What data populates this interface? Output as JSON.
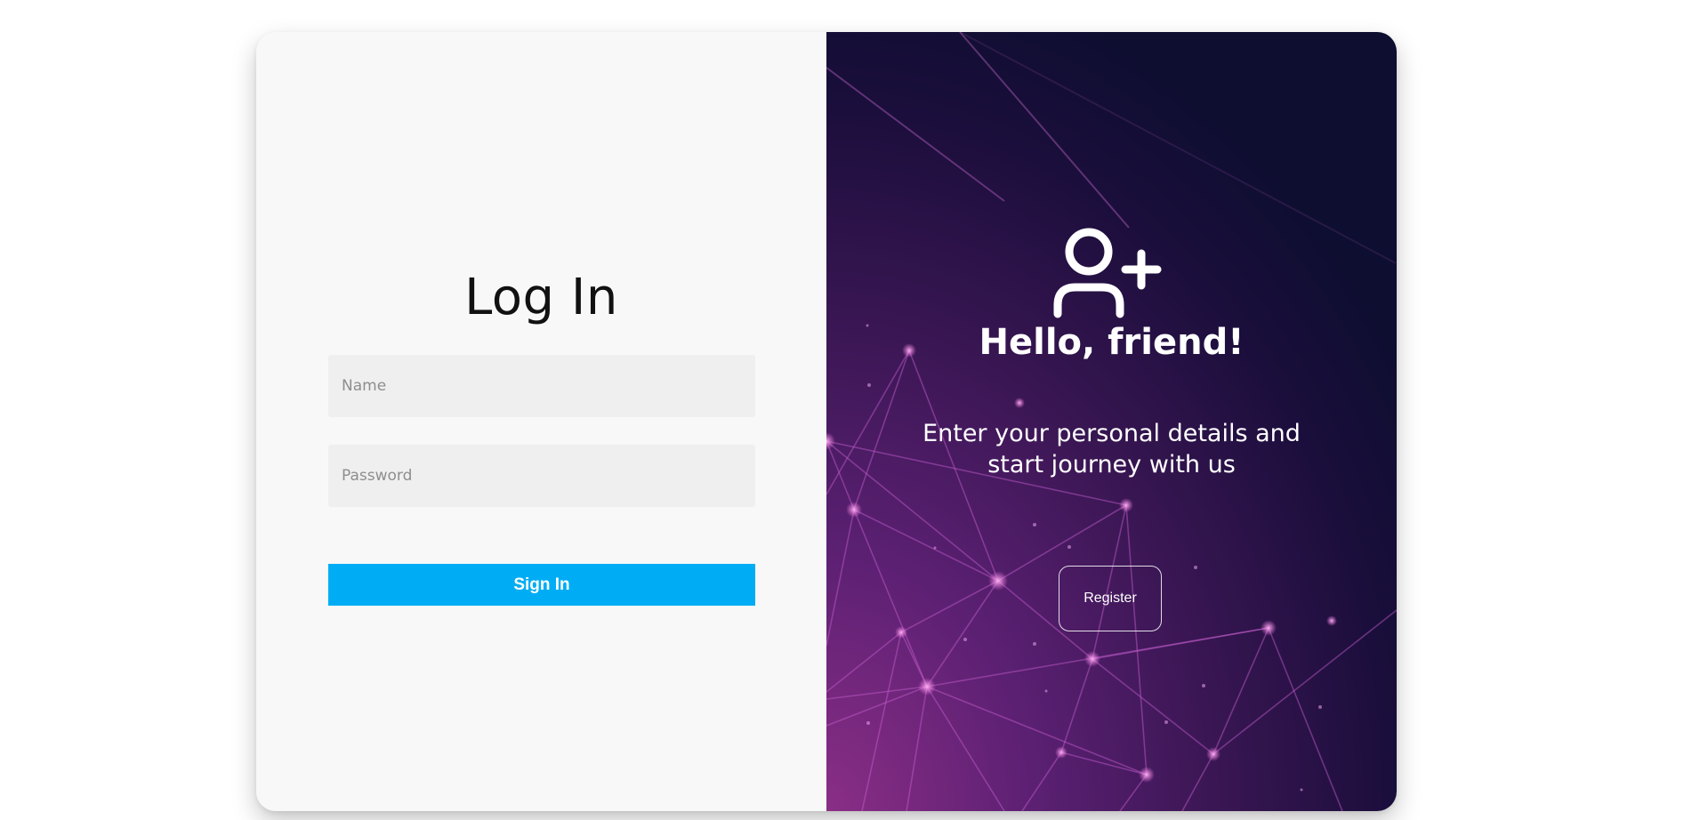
{
  "login": {
    "title": "Log In",
    "name_placeholder": "Name",
    "password_placeholder": "Password",
    "signin_label": "Sign In"
  },
  "promo": {
    "icon": "user-plus-icon",
    "heading": "Hello, friend!",
    "description": "Enter your personal details and start journey with us",
    "register_label": "Register"
  },
  "colors": {
    "signin_button": "#00adf5",
    "promo_gradient_start": "#8a2e86",
    "promo_gradient_end": "#0d0e30"
  }
}
